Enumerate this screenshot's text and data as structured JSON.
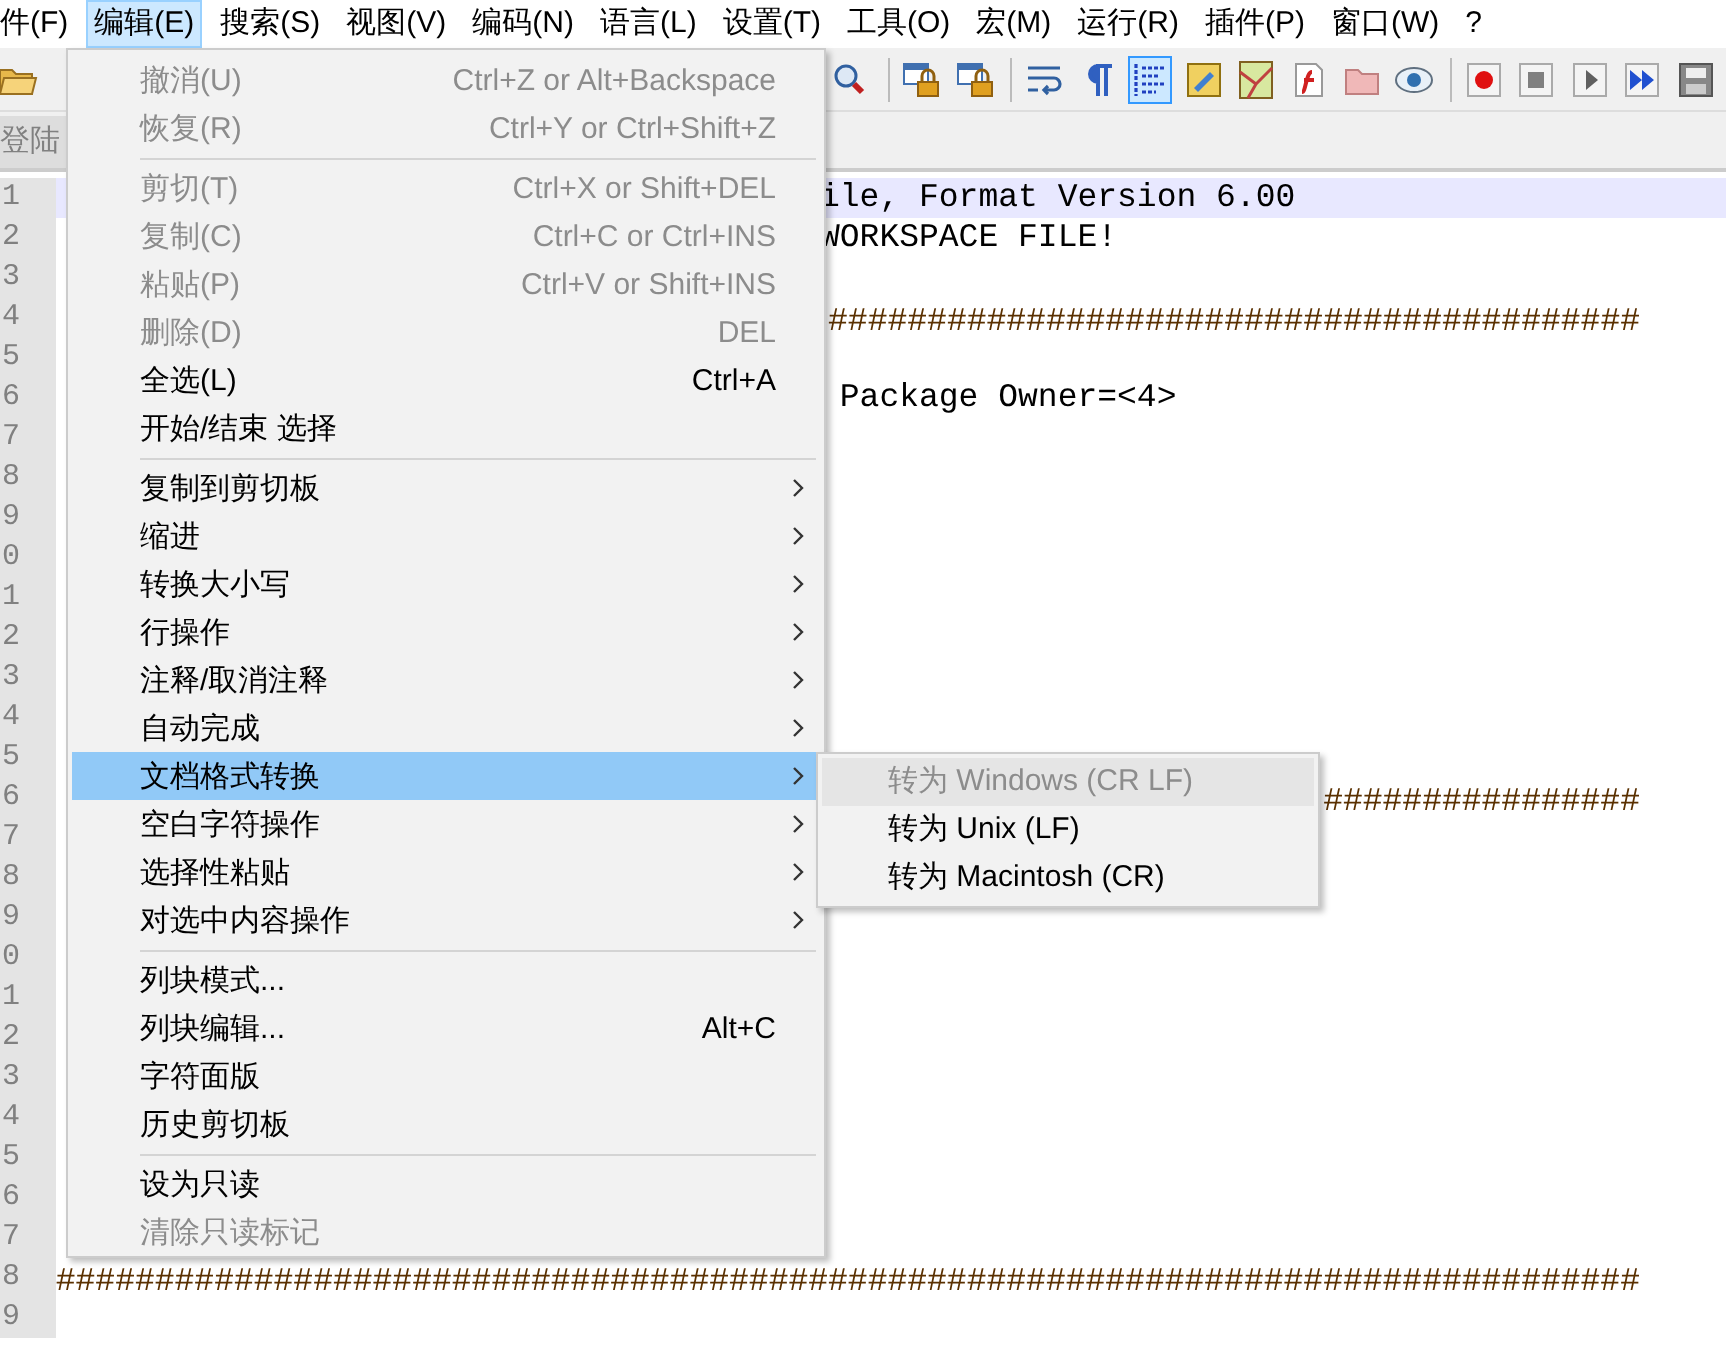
{
  "menubar": [
    {
      "label": "件(F)",
      "selected": false
    },
    {
      "label": "编辑(E)",
      "selected": true
    },
    {
      "label": "搜索(S)",
      "selected": false
    },
    {
      "label": "视图(V)",
      "selected": false
    },
    {
      "label": "编码(N)",
      "selected": false
    },
    {
      "label": "语言(L)",
      "selected": false
    },
    {
      "label": "设置(T)",
      "selected": false
    },
    {
      "label": "工具(O)",
      "selected": false
    },
    {
      "label": "宏(M)",
      "selected": false
    },
    {
      "label": "运行(R)",
      "selected": false
    },
    {
      "label": "插件(P)",
      "selected": false
    },
    {
      "label": "窗口(W)",
      "selected": false
    },
    {
      "label": "?",
      "selected": false
    }
  ],
  "toolbar": {
    "left": [
      {
        "kind": "open",
        "selected": false
      }
    ],
    "right": [
      {
        "kind": "find",
        "selected": false
      },
      {
        "kind": "sep"
      },
      {
        "kind": "sync-v",
        "selected": false
      },
      {
        "kind": "sync-h",
        "selected": false
      },
      {
        "kind": "sep"
      },
      {
        "kind": "wrap",
        "selected": false
      },
      {
        "kind": "pilcrow",
        "selected": false
      },
      {
        "kind": "indent",
        "selected": true
      },
      {
        "kind": "udl",
        "selected": false
      },
      {
        "kind": "map",
        "selected": false
      },
      {
        "kind": "function",
        "selected": false
      },
      {
        "kind": "folder",
        "selected": false
      },
      {
        "kind": "eye",
        "selected": false
      },
      {
        "kind": "sep"
      },
      {
        "kind": "record",
        "selected": false
      },
      {
        "kind": "stop",
        "selected": false
      },
      {
        "kind": "play",
        "selected": false
      },
      {
        "kind": "play-multi",
        "selected": false
      },
      {
        "kind": "save",
        "selected": false
      }
    ]
  },
  "tab": {
    "label": "登陆"
  },
  "editor": {
    "lines": [
      {
        "number": "1",
        "kind": "text",
        "text": "ile, Format Version 6.00",
        "current": true
      },
      {
        "number": "2",
        "kind": "text",
        "text": "WORKSPACE FILE!",
        "current": false
      },
      {
        "number": "3",
        "current": false
      },
      {
        "number": "4",
        "kind": "rule",
        "text": "#########################################",
        "current": false
      },
      {
        "number": "5",
        "current": false
      },
      {
        "number": "6",
        "kind": "text",
        "text": " Package Owner=<4>",
        "current": false
      },
      {
        "number": "7",
        "current": false
      },
      {
        "number": "8",
        "current": false
      },
      {
        "number": "9",
        "current": false
      },
      {
        "number": "0",
        "current": false
      },
      {
        "number": "1",
        "current": false
      },
      {
        "number": "2",
        "current": false
      },
      {
        "number": "3",
        "current": false
      },
      {
        "number": "4",
        "current": false
      },
      {
        "number": "5",
        "current": false
      },
      {
        "number": "6",
        "kind": "rule",
        "text": "################",
        "current": false
      },
      {
        "number": "7",
        "current": false
      },
      {
        "number": "8",
        "current": false
      },
      {
        "number": "9",
        "current": false
      },
      {
        "number": "0",
        "current": false
      },
      {
        "number": "1",
        "current": false
      },
      {
        "number": "2",
        "current": false
      },
      {
        "number": "3",
        "current": false
      },
      {
        "number": "4",
        "current": false
      },
      {
        "number": "5",
        "current": false
      },
      {
        "number": "6",
        "current": false
      },
      {
        "number": "7",
        "current": false
      },
      {
        "number": "8",
        "kind": "rule",
        "text": "################################################################################",
        "current": false
      },
      {
        "number": "9",
        "current": false
      }
    ]
  },
  "menu": {
    "items": [
      {
        "kind": "item",
        "label": "撤消(U)",
        "shortcut": "Ctrl+Z or Alt+Backspace",
        "disabled": true,
        "selected": false,
        "submenu": false
      },
      {
        "kind": "item",
        "label": "恢复(R)",
        "shortcut": "Ctrl+Y or Ctrl+Shift+Z",
        "disabled": true,
        "selected": false,
        "submenu": false
      },
      {
        "kind": "separator"
      },
      {
        "kind": "item",
        "label": "剪切(T)",
        "shortcut": "Ctrl+X or Shift+DEL",
        "disabled": true,
        "selected": false,
        "submenu": false
      },
      {
        "kind": "item",
        "label": "复制(C)",
        "shortcut": "Ctrl+C or Ctrl+INS",
        "disabled": true,
        "selected": false,
        "submenu": false
      },
      {
        "kind": "item",
        "label": "粘贴(P)",
        "shortcut": "Ctrl+V or Shift+INS",
        "disabled": true,
        "selected": false,
        "submenu": false
      },
      {
        "kind": "item",
        "label": "删除(D)",
        "shortcut": "DEL",
        "disabled": true,
        "selected": false,
        "submenu": false
      },
      {
        "kind": "item",
        "label": "全选(L)",
        "shortcut": "Ctrl+A",
        "disabled": false,
        "selected": false,
        "submenu": false
      },
      {
        "kind": "item",
        "label": "开始/结束 选择",
        "disabled": false,
        "selected": false,
        "submenu": false
      },
      {
        "kind": "separator"
      },
      {
        "kind": "item",
        "label": "复制到剪切板",
        "disabled": false,
        "selected": false,
        "submenu": true
      },
      {
        "kind": "item",
        "label": "缩进",
        "disabled": false,
        "selected": false,
        "submenu": true
      },
      {
        "kind": "item",
        "label": "转换大小写",
        "disabled": false,
        "selected": false,
        "submenu": true
      },
      {
        "kind": "item",
        "label": "行操作",
        "disabled": false,
        "selected": false,
        "submenu": true
      },
      {
        "kind": "item",
        "label": "注释/取消注释",
        "disabled": false,
        "selected": false,
        "submenu": true
      },
      {
        "kind": "item",
        "label": "自动完成",
        "disabled": false,
        "selected": false,
        "submenu": true
      },
      {
        "kind": "item",
        "label": "文档格式转换",
        "disabled": false,
        "selected": true,
        "submenu": true
      },
      {
        "kind": "item",
        "label": "空白字符操作",
        "disabled": false,
        "selected": false,
        "submenu": true
      },
      {
        "kind": "item",
        "label": "选择性粘贴",
        "disabled": false,
        "selected": false,
        "submenu": true
      },
      {
        "kind": "item",
        "label": "对选中内容操作",
        "disabled": false,
        "selected": false,
        "submenu": true
      },
      {
        "kind": "separator"
      },
      {
        "kind": "item",
        "label": "列块模式...",
        "disabled": false,
        "selected": false,
        "submenu": false
      },
      {
        "kind": "item",
        "label": "列块编辑...",
        "shortcut": "Alt+C",
        "disabled": false,
        "selected": false,
        "submenu": false
      },
      {
        "kind": "item",
        "label": "字符面版",
        "disabled": false,
        "selected": false,
        "submenu": false
      },
      {
        "kind": "item",
        "label": "历史剪切板",
        "disabled": false,
        "selected": false,
        "submenu": false
      },
      {
        "kind": "separator"
      },
      {
        "kind": "item",
        "label": "设为只读",
        "disabled": false,
        "selected": false,
        "submenu": false
      },
      {
        "kind": "item",
        "label": "清除只读标记",
        "disabled": true,
        "selected": false,
        "submenu": false
      }
    ]
  },
  "submenu": {
    "items": [
      {
        "label": "转为 Windows (CR LF)",
        "disabled": true,
        "selected": true
      },
      {
        "label": "转为 Unix (LF)",
        "disabled": false,
        "selected": false
      },
      {
        "label": "转为 Macintosh (CR)",
        "disabled": false,
        "selected": false
      }
    ]
  }
}
